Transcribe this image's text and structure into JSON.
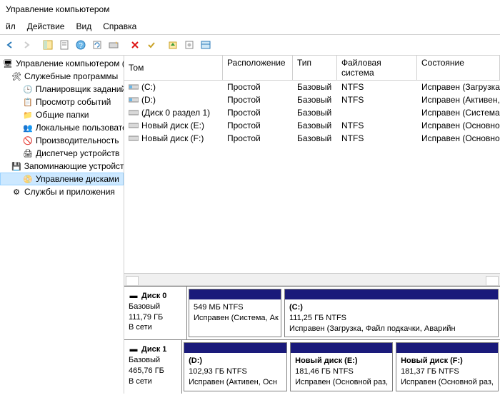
{
  "window": {
    "title": "Управление компьютером"
  },
  "menu": {
    "file": "йл",
    "action": "Действие",
    "view": "Вид",
    "help": "Справка"
  },
  "tree": {
    "root": "Управление компьютером (лс",
    "tools": "Служебные программы",
    "scheduler": "Планировщик заданий",
    "events": "Просмотр событий",
    "shared": "Общие папки",
    "users": "Локальные пользовате",
    "perf": "Производительность",
    "devmgr": "Диспетчер устройств",
    "storage": "Запоминающие устройств",
    "diskmgmt": "Управление дисками",
    "services": "Службы и приложения"
  },
  "cols": {
    "vol": "Том",
    "layout": "Расположение",
    "type": "Тип",
    "fs": "Файловая система",
    "status": "Состояние"
  },
  "vols": [
    {
      "name": "(C:)",
      "layout": "Простой",
      "type": "Базовый",
      "fs": "NTFS",
      "status": "Исправен (Загрузка, Файл подкачки,"
    },
    {
      "name": "(D:)",
      "layout": "Простой",
      "type": "Базовый",
      "fs": "NTFS",
      "status": "Исправен (Активен, Основной разде"
    },
    {
      "name": "(Диск 0 раздел 1)",
      "layout": "Простой",
      "type": "Базовый",
      "fs": "",
      "status": "Исправен (Система, Активен, Основ"
    },
    {
      "name": "Новый диск (E:)",
      "layout": "Простой",
      "type": "Базовый",
      "fs": "NTFS",
      "status": "Исправен (Основной раздел)"
    },
    {
      "name": "Новый диск (F:)",
      "layout": "Простой",
      "type": "Базовый",
      "fs": "NTFS",
      "status": "Исправен (Основной раздел)"
    }
  ],
  "disk0": {
    "title": "Диск 0",
    "type": "Базовый",
    "size": "111,79 ГБ",
    "state": "В сети",
    "p1": {
      "name": "",
      "size": "549 МБ NTFS",
      "status": "Исправен (Система, Ак"
    },
    "p2": {
      "name": "(C:)",
      "size": "111,25 ГБ NTFS",
      "status": "Исправен (Загрузка, Файл подкачки, Аварийн"
    }
  },
  "disk1": {
    "title": "Диск 1",
    "type": "Базовый",
    "size": "465,76 ГБ",
    "state": "В сети",
    "p1": {
      "name": "(D:)",
      "size": "102,93 ГБ NTFS",
      "status": "Исправен (Активен, Осн"
    },
    "p2": {
      "name": "Новый диск  (E:)",
      "size": "181,46 ГБ NTFS",
      "status": "Исправен (Основной раз,"
    },
    "p3": {
      "name": "Новый диск  (F:)",
      "size": "181,37 ГБ NTFS",
      "status": "Исправен (Основной раз,"
    }
  }
}
